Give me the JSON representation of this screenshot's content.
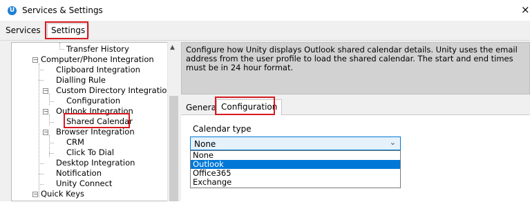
{
  "window": {
    "title": "Services & Settings",
    "app_icon_letter": "U",
    "close_glyph": "×"
  },
  "top_tabs": {
    "services": "Services",
    "settings": "Settings"
  },
  "tree": {
    "items": [
      {
        "label": "Transfer History"
      },
      {
        "label": "Computer/Phone Integration"
      },
      {
        "label": "Clipboard Integration"
      },
      {
        "label": "Dialling Rule"
      },
      {
        "label": "Custom Directory Integration"
      },
      {
        "label": "Configuration"
      },
      {
        "label": "Outlook Integration"
      },
      {
        "label": "Shared Calendar"
      },
      {
        "label": "Browser Integration"
      },
      {
        "label": "CRM"
      },
      {
        "label": "Click To Dial"
      },
      {
        "label": "Desktop Integration"
      },
      {
        "label": "Notification"
      },
      {
        "label": "Unity Connect"
      },
      {
        "label": "Quick Keys"
      }
    ],
    "expander_glyph": "−"
  },
  "info": {
    "text": "Configure how Unity displays Outlook shared calendar details.  Unity uses the email address from the user profile to load the shared calendar.  The start and end times must be in 24 hour format."
  },
  "panel_tabs": {
    "general": "General",
    "configuration": "Configuration"
  },
  "calendar_type": {
    "label": "Calendar type",
    "selected": "None",
    "arrow": "⌄",
    "options": [
      "None",
      "Outlook",
      "Office365",
      "Exchange"
    ],
    "highlighted": "Outlook"
  },
  "colors": {
    "highlight": "#d71921",
    "accent": "#0078d7"
  }
}
